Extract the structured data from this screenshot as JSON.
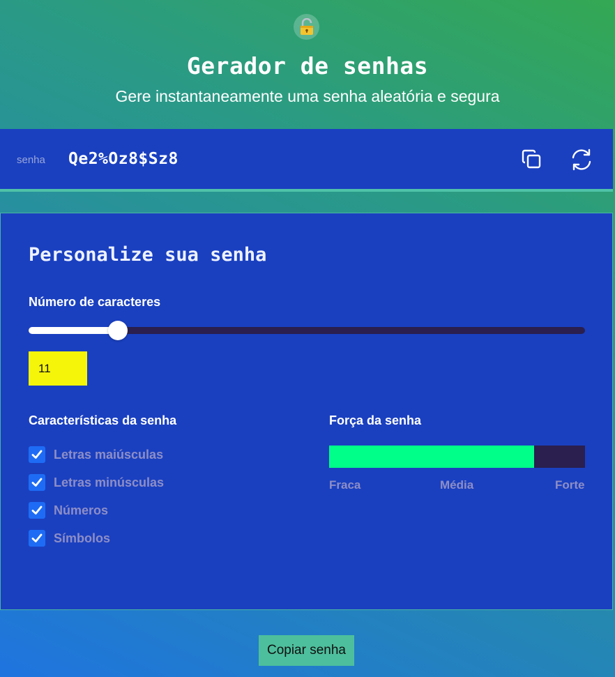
{
  "header": {
    "icon": "lock-icon",
    "title": "Gerador de senhas",
    "subtitle": "Gere instantaneamente uma senha aleatória e segura"
  },
  "password": {
    "label": "senha",
    "value": "Qe2%Oz8$Sz8",
    "copy_icon": "copy-icon",
    "refresh_icon": "refresh-icon"
  },
  "panel": {
    "title": "Personalize sua senha",
    "length_label": "Número de caracteres",
    "length_value": "11",
    "slider_fraction": 0.16,
    "features_title": "Características da senha",
    "options": [
      {
        "label": "Letras maiúsculas",
        "checked": true
      },
      {
        "label": "Letras minúsculas",
        "checked": true
      },
      {
        "label": "Números",
        "checked": true
      },
      {
        "label": "Símbolos",
        "checked": true
      }
    ],
    "strength_title": "Força da senha",
    "strength_fraction": 0.8,
    "strength_labels": [
      "Fraca",
      "Média",
      "Forte"
    ]
  },
  "copy_button": "Copiar senha",
  "colors": {
    "strength_fill": "#00ff88",
    "length_input_bg": "#f5f50a",
    "checkbox": "#1e6cf5",
    "panel_bg": "#1a40c0"
  }
}
